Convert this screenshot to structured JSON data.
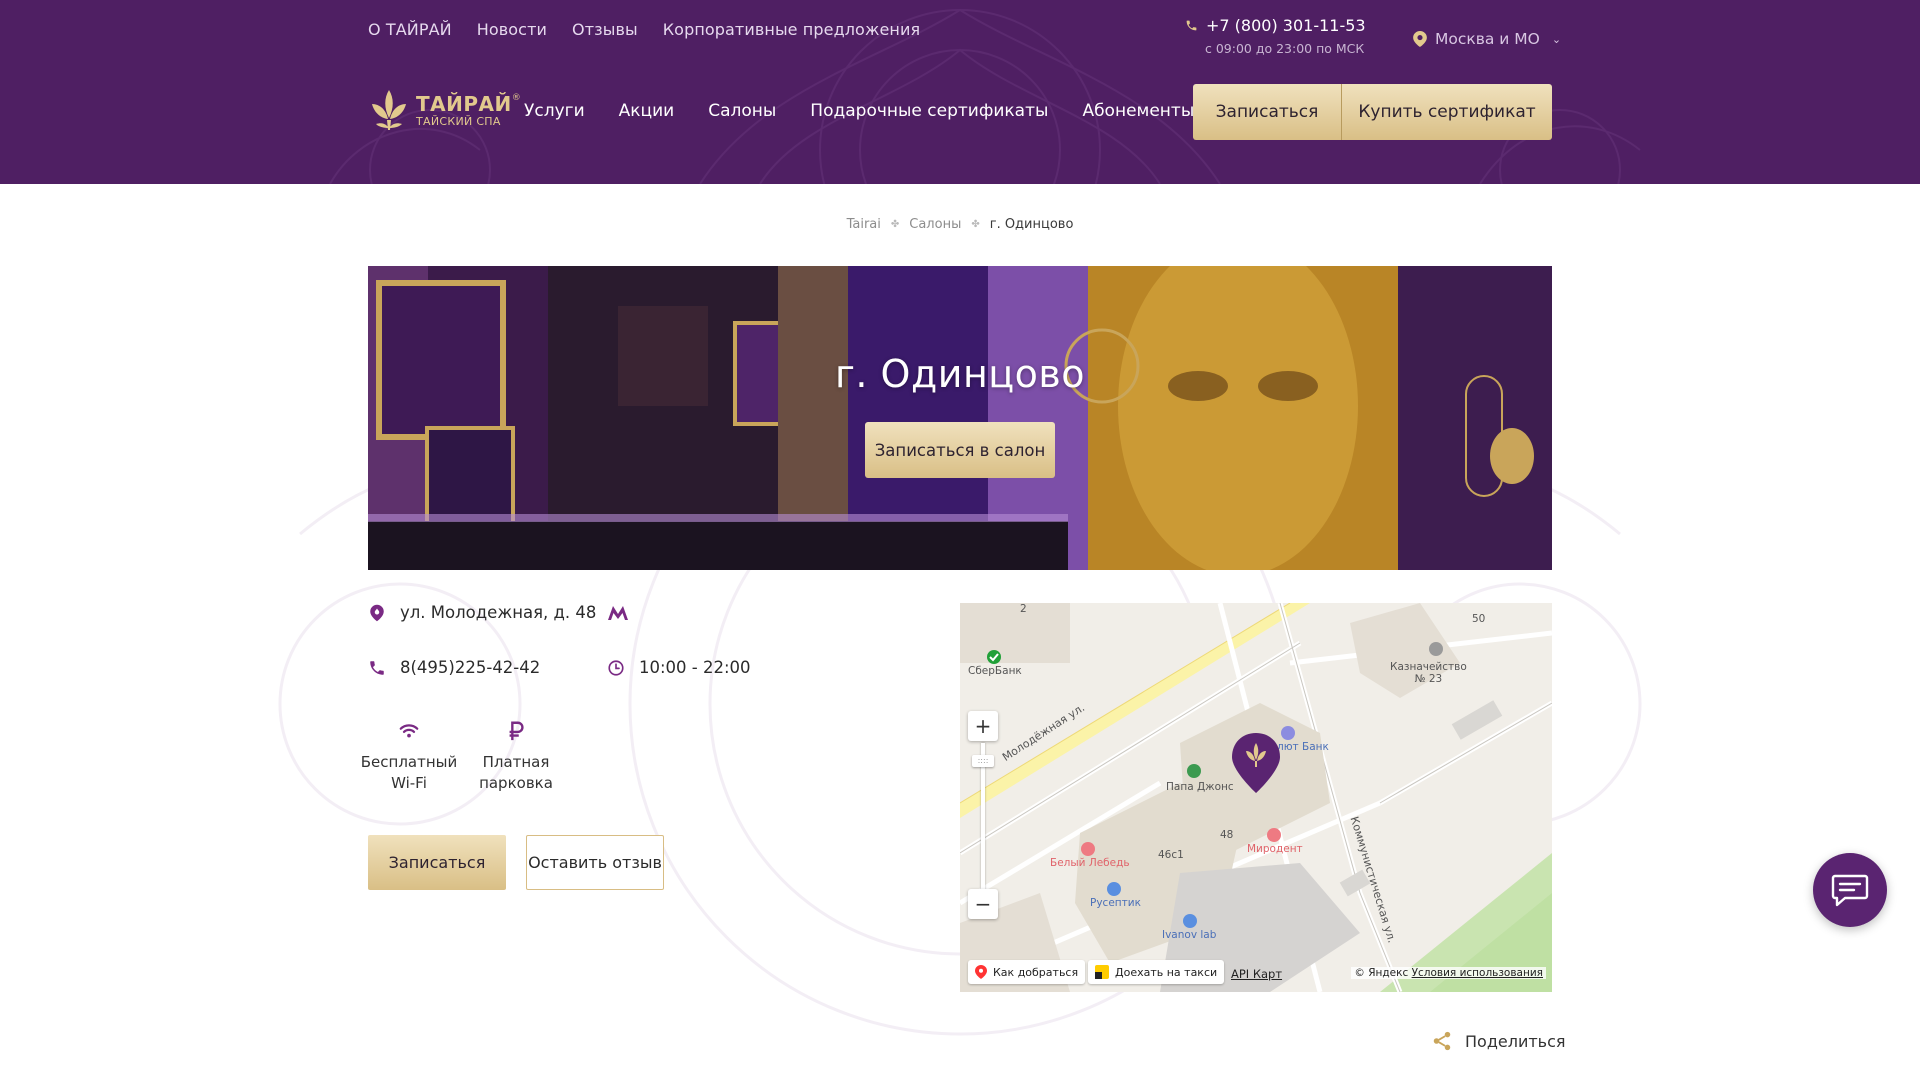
{
  "colors": {
    "header_bg": "#4f1f63",
    "accent_purple": "#7a2a84",
    "gold_light": "#f0e1bd",
    "gold_dark": "#d9bf86",
    "chat_bg": "#5a2471"
  },
  "top_nav": {
    "items": [
      "О ТАЙРАЙ",
      "Новости",
      "Отзывы",
      "Корпоративные предложения"
    ]
  },
  "contact": {
    "phone_icon": "phone-icon",
    "phone": "+7 (800) 301-11-53",
    "hours": "с 09:00 до 23:00 по МСК"
  },
  "city": {
    "icon": "location-pin-icon",
    "label": "Москва и МО",
    "chevron": "⌄"
  },
  "logo": {
    "name": "ТАЙРАЙ",
    "reg": "®",
    "subtitle": "ТАЙСКИЙ СПА"
  },
  "main_nav": {
    "items": [
      "Услуги",
      "Акции",
      "Салоны",
      "Подарочные сертификаты",
      "Абонементы"
    ]
  },
  "header_buttons": {
    "book": "Записаться",
    "buy_certificate": "Купить сертификат"
  },
  "breadcrumb": {
    "items": [
      "Tairai",
      "Салоны"
    ],
    "current": "г. Одинцово",
    "separator": "✤"
  },
  "hero": {
    "title": "г. Одинцово",
    "button": "Записаться в салон"
  },
  "salon": {
    "address": "ул. Молодежная, д. 48",
    "metro_icon": "metro-icon",
    "phone": "8(495)225-42-42",
    "hours": "10:00 - 22:00",
    "amenities": [
      {
        "icon": "wifi-icon",
        "line1": "Бесплатный",
        "line2": "Wi-Fi"
      },
      {
        "icon": "ruble-icon",
        "line1": "Платная",
        "line2": "парковка"
      }
    ],
    "book_button": "Записаться",
    "review_button": "Оставить отзыв"
  },
  "map": {
    "labels": {
      "sberbank": "СберБанк",
      "treasury": "Казначейство\n№ 23",
      "house_50": "50",
      "bank": "лют Банк",
      "papa_johns": "Папа Джонс",
      "mirodent": "Миродент",
      "house_48": "48",
      "house_46c1": "46с1",
      "white_swan": "Белый Лебедь",
      "ruseptic": "Русептик",
      "ivanov_lab": "Ivanov lab",
      "street_molodezhnaya": "Молодёжная ул.",
      "street_kommunisticheskaya": "Коммунистическая ул.",
      "house_2": "2"
    },
    "zoom_in": "+",
    "zoom_out": "−",
    "zoom_handle": "::::",
    "route_button": "Как добраться",
    "taxi_button": "Доехать на такси",
    "api_link": "API Карт",
    "copyright": "© Яндекс",
    "terms": "Условия использования"
  },
  "share": {
    "label": "Поделиться"
  }
}
